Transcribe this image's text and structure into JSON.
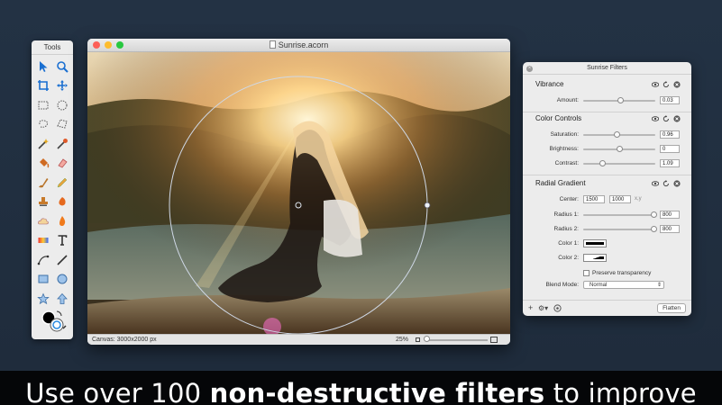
{
  "tools_palette": {
    "title": "Tools",
    "tools": [
      "pointer-icon",
      "zoom-icon",
      "crop-icon",
      "move-icon",
      "rect-select-icon",
      "ellipse-select-icon",
      "lasso-icon",
      "polygon-lasso-icon",
      "magic-wand-icon",
      "color-wand-icon",
      "paint-bucket-icon",
      "eraser-icon",
      "brush-icon",
      "pencil-icon",
      "clone-stamp-icon",
      "smudge-icon",
      "cloud-icon",
      "burn-icon",
      "gradient-icon",
      "text-icon",
      "bezier-pen-icon",
      "line-icon",
      "rectangle-shape-icon",
      "oval-shape-icon",
      "star-shape-icon",
      "arrow-shape-icon"
    ]
  },
  "main_window": {
    "title": "Sunrise.acorn",
    "status": {
      "canvas_size": "Canvas: 3000x2000 px",
      "zoom": "25%"
    }
  },
  "filters_panel": {
    "title": "Sunrise Filters",
    "sections": {
      "vibrance": {
        "title": "Vibrance",
        "amount_label": "Amount:",
        "amount_value": "0.03",
        "amount_fraction": 0.52
      },
      "color_controls": {
        "title": "Color Controls",
        "saturation_label": "Saturation:",
        "saturation_value": "0.96",
        "saturation_fraction": 0.47,
        "brightness_label": "Brightness:",
        "brightness_value": "0",
        "brightness_fraction": 0.5,
        "contrast_label": "Contrast:",
        "contrast_value": "1.09",
        "contrast_fraction": 0.27
      },
      "radial_gradient": {
        "title": "Radial Gradient",
        "center_label": "Center:",
        "center_x": "1500",
        "center_y": "1000",
        "center_suffix": "x,y",
        "radius1_label": "Radius 1:",
        "radius1_value": "800",
        "radius1_fraction": 0.98,
        "radius2_label": "Radius 2:",
        "radius2_value": "800",
        "radius2_fraction": 0.98,
        "color1_label": "Color 1:",
        "color2_label": "Color 2:",
        "preserve_label": "Preserve transparency",
        "blend_label": "Blend Mode:",
        "blend_value": "Normal"
      }
    },
    "footer": {
      "add_label": "+",
      "gear_label": "⚙▾",
      "flatten_label": "Flatten"
    }
  },
  "caption": {
    "prefix": "Use over 100 ",
    "bold": "non-destructive filters",
    "suffix": " to improve"
  },
  "colors": {
    "close_light": "#fc5f57",
    "minimize_light": "#fdbc2e",
    "zoom_light": "#28c840"
  }
}
